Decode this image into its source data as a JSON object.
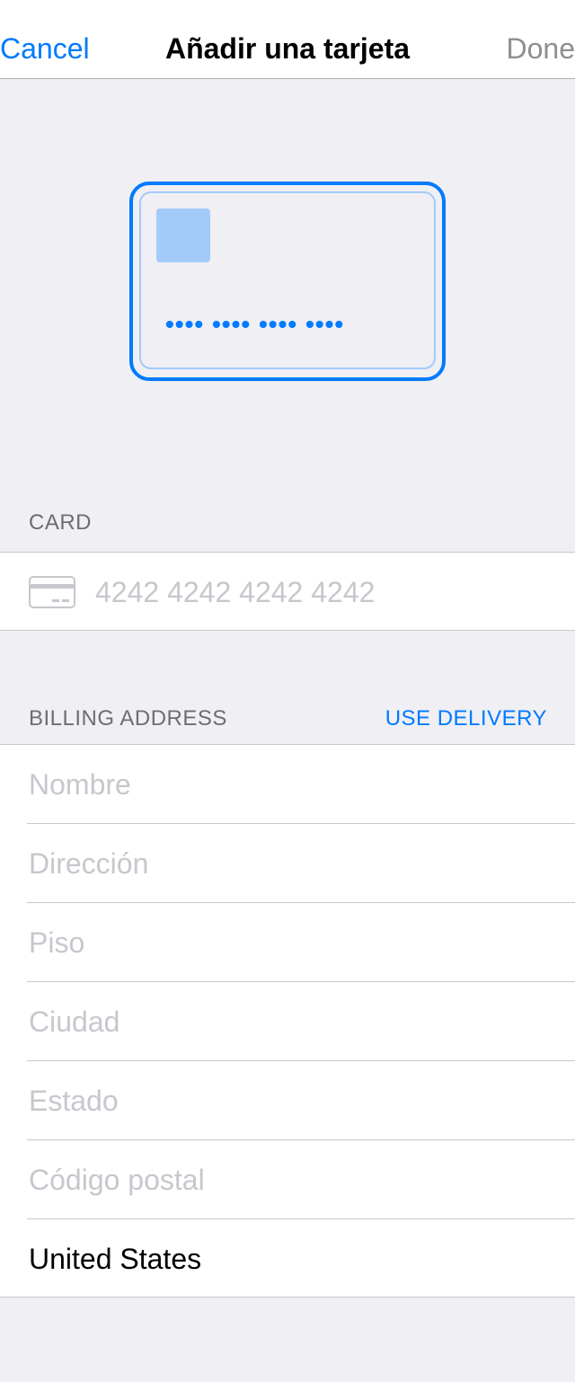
{
  "navbar": {
    "cancel_label": "Cancel",
    "title": "Añadir una tarjeta",
    "done_label": "Done"
  },
  "card_preview": {
    "number_mask": "•••• •••• •••• ••••"
  },
  "card_section": {
    "header": "CARD",
    "number_placeholder": "4242 4242 4242 4242",
    "number_value": ""
  },
  "billing_section": {
    "header": "BILLING ADDRESS",
    "action_label": "USE DELIVERY",
    "fields": [
      {
        "placeholder": "Nombre",
        "value": ""
      },
      {
        "placeholder": "Dirección",
        "value": ""
      },
      {
        "placeholder": "Piso",
        "value": ""
      },
      {
        "placeholder": "Ciudad",
        "value": ""
      },
      {
        "placeholder": "Estado",
        "value": ""
      },
      {
        "placeholder": "Código postal",
        "value": ""
      }
    ],
    "country_value": "United States"
  },
  "colors": {
    "accent": "#007aff",
    "background": "#efeff4",
    "placeholder": "#c7c7cd",
    "disabled": "#8e8e93"
  },
  "icons": {
    "card": "credit-card-icon"
  }
}
